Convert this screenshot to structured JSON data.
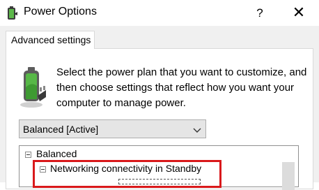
{
  "window": {
    "title": "Power Options",
    "help_label": "?",
    "close_label": "✕"
  },
  "tabs": [
    {
      "label": "Advanced settings"
    }
  ],
  "description": "Select the power plan that you want to customize, and then choose settings that reflect how you want your computer to manage power.",
  "plan_select": {
    "value": "Balanced [Active]"
  },
  "tree": {
    "items": [
      {
        "label": "Balanced",
        "state": "expanded"
      },
      {
        "label": "Networking connectivity in Standby",
        "state": "expanded"
      }
    ]
  },
  "icons": {
    "app": "power-options-icon",
    "battery": "battery-plug-icon",
    "chevron": "chevron-down-icon"
  },
  "colors": {
    "highlight": "#d9191b",
    "battery_green": "#57b847"
  }
}
